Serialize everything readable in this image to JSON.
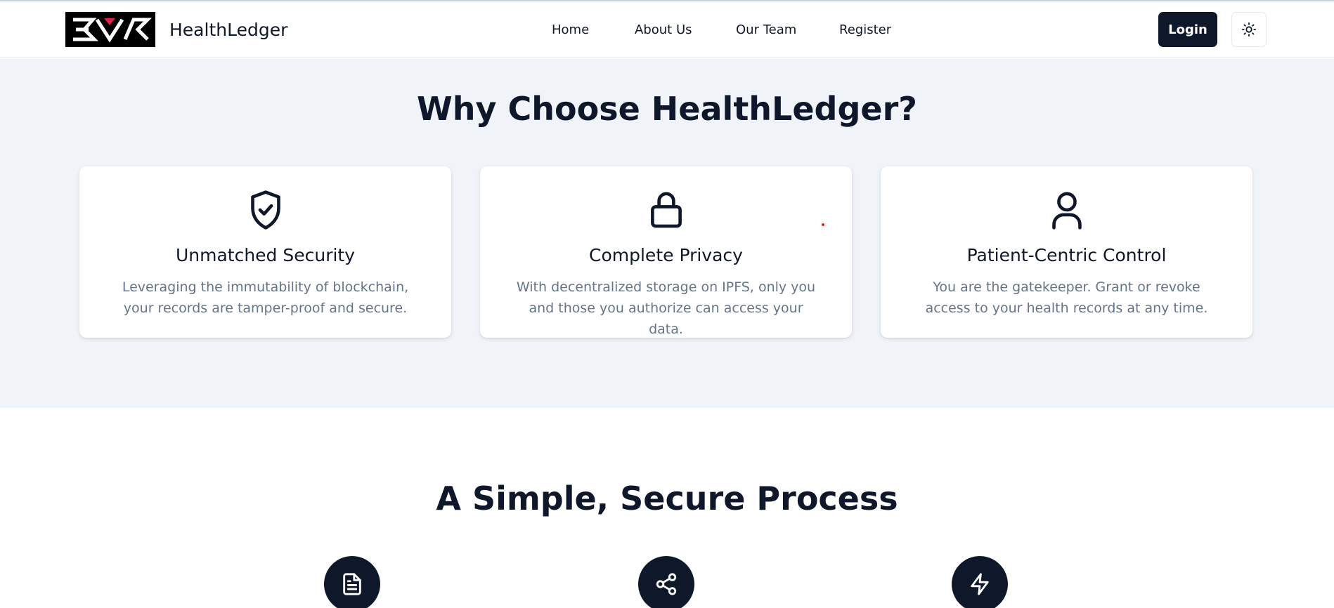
{
  "navbar": {
    "brand": "HealthLedger",
    "links": [
      "Home",
      "About Us",
      "Our Team",
      "Register"
    ],
    "login_label": "Login"
  },
  "why": {
    "title": "Why Choose HealthLedger?",
    "cards": [
      {
        "icon": "shield-check-icon",
        "title": "Unmatched Security",
        "desc": "Leveraging the immutability of blockchain, your records are tamper-proof and secure."
      },
      {
        "icon": "lock-icon",
        "title": "Complete Privacy",
        "desc": "With decentralized storage on IPFS, only you and those you authorize can access your data."
      },
      {
        "icon": "user-icon",
        "title": "Patient-Centric Control",
        "desc": "You are the gatekeeper. Grant or revoke access to your health records at any time."
      }
    ]
  },
  "process": {
    "title": "A Simple, Secure Process",
    "steps": [
      {
        "icon": "document-icon"
      },
      {
        "icon": "share-icon"
      },
      {
        "icon": "lightning-icon"
      }
    ]
  },
  "colors": {
    "primary": "#0f172a",
    "section_bg": "#f0f4f9",
    "muted_text": "#64748b"
  }
}
